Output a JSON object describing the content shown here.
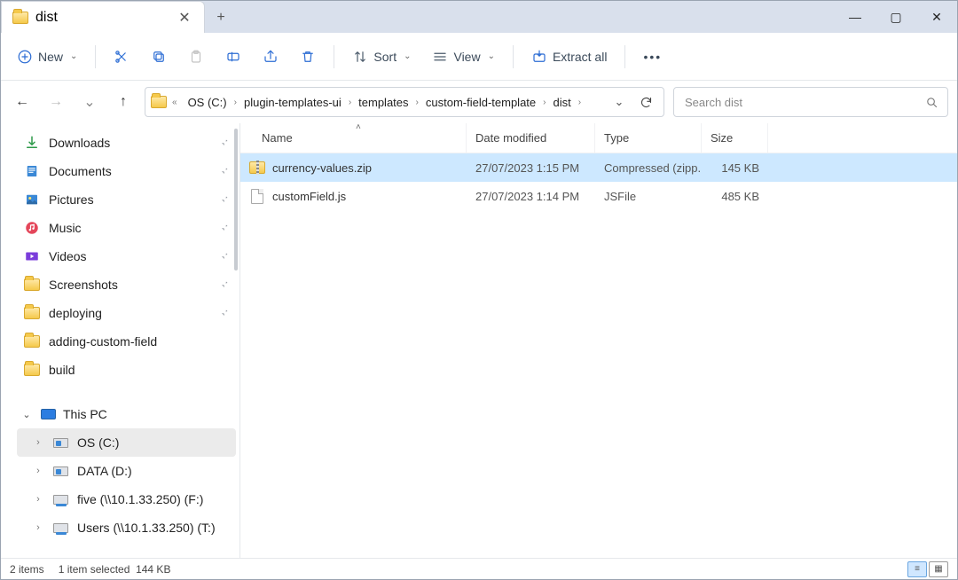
{
  "window": {
    "tab_title": "dist",
    "controls": {
      "min": "—",
      "max": "▢",
      "close": "✕",
      "newtab": "+"
    }
  },
  "toolbar": {
    "new": "New",
    "sort": "Sort",
    "view": "View",
    "extract": "Extract all"
  },
  "nav": {
    "history_dropdown": "⌄",
    "up": "↑"
  },
  "breadcrumbs": [
    "OS (C:)",
    "plugin-templates-ui",
    "templates",
    "custom-field-template",
    "dist"
  ],
  "search_placeholder": "Search dist",
  "sidebar": {
    "quick": [
      {
        "label": "Downloads",
        "icon": "download",
        "pin": true
      },
      {
        "label": "Documents",
        "icon": "doc",
        "pin": true
      },
      {
        "label": "Pictures",
        "icon": "pic",
        "pin": true
      },
      {
        "label": "Music",
        "icon": "music",
        "pin": true
      },
      {
        "label": "Videos",
        "icon": "video",
        "pin": true
      },
      {
        "label": "Screenshots",
        "icon": "folder",
        "pin": true
      },
      {
        "label": "deploying",
        "icon": "folder",
        "pin": true
      },
      {
        "label": "adding-custom-field",
        "icon": "folder",
        "pin": false
      },
      {
        "label": "build",
        "icon": "folder",
        "pin": false
      }
    ],
    "pc_label": "This PC",
    "drives": [
      {
        "label": "OS (C:)",
        "selected": true,
        "icon": "drive"
      },
      {
        "label": "DATA (D:)",
        "selected": false,
        "icon": "drive"
      },
      {
        "label": "five (\\\\10.1.33.250) (F:)",
        "selected": false,
        "icon": "netdrive"
      },
      {
        "label": "Users (\\\\10.1.33.250) (T:)",
        "selected": false,
        "icon": "netdrive"
      }
    ]
  },
  "columns": {
    "name": "Name",
    "date": "Date modified",
    "type": "Type",
    "size": "Size"
  },
  "files": [
    {
      "name": "currency-values.zip",
      "date": "27/07/2023 1:15 PM",
      "type": "Compressed (zipp...",
      "size": "145 KB",
      "icon": "zip",
      "selected": true
    },
    {
      "name": "customField.js",
      "date": "27/07/2023 1:14 PM",
      "type": "JSFile",
      "size": "485 KB",
      "icon": "file",
      "selected": false
    }
  ],
  "status": {
    "items": "2 items",
    "selected": "1 item selected",
    "size": "144 KB"
  }
}
